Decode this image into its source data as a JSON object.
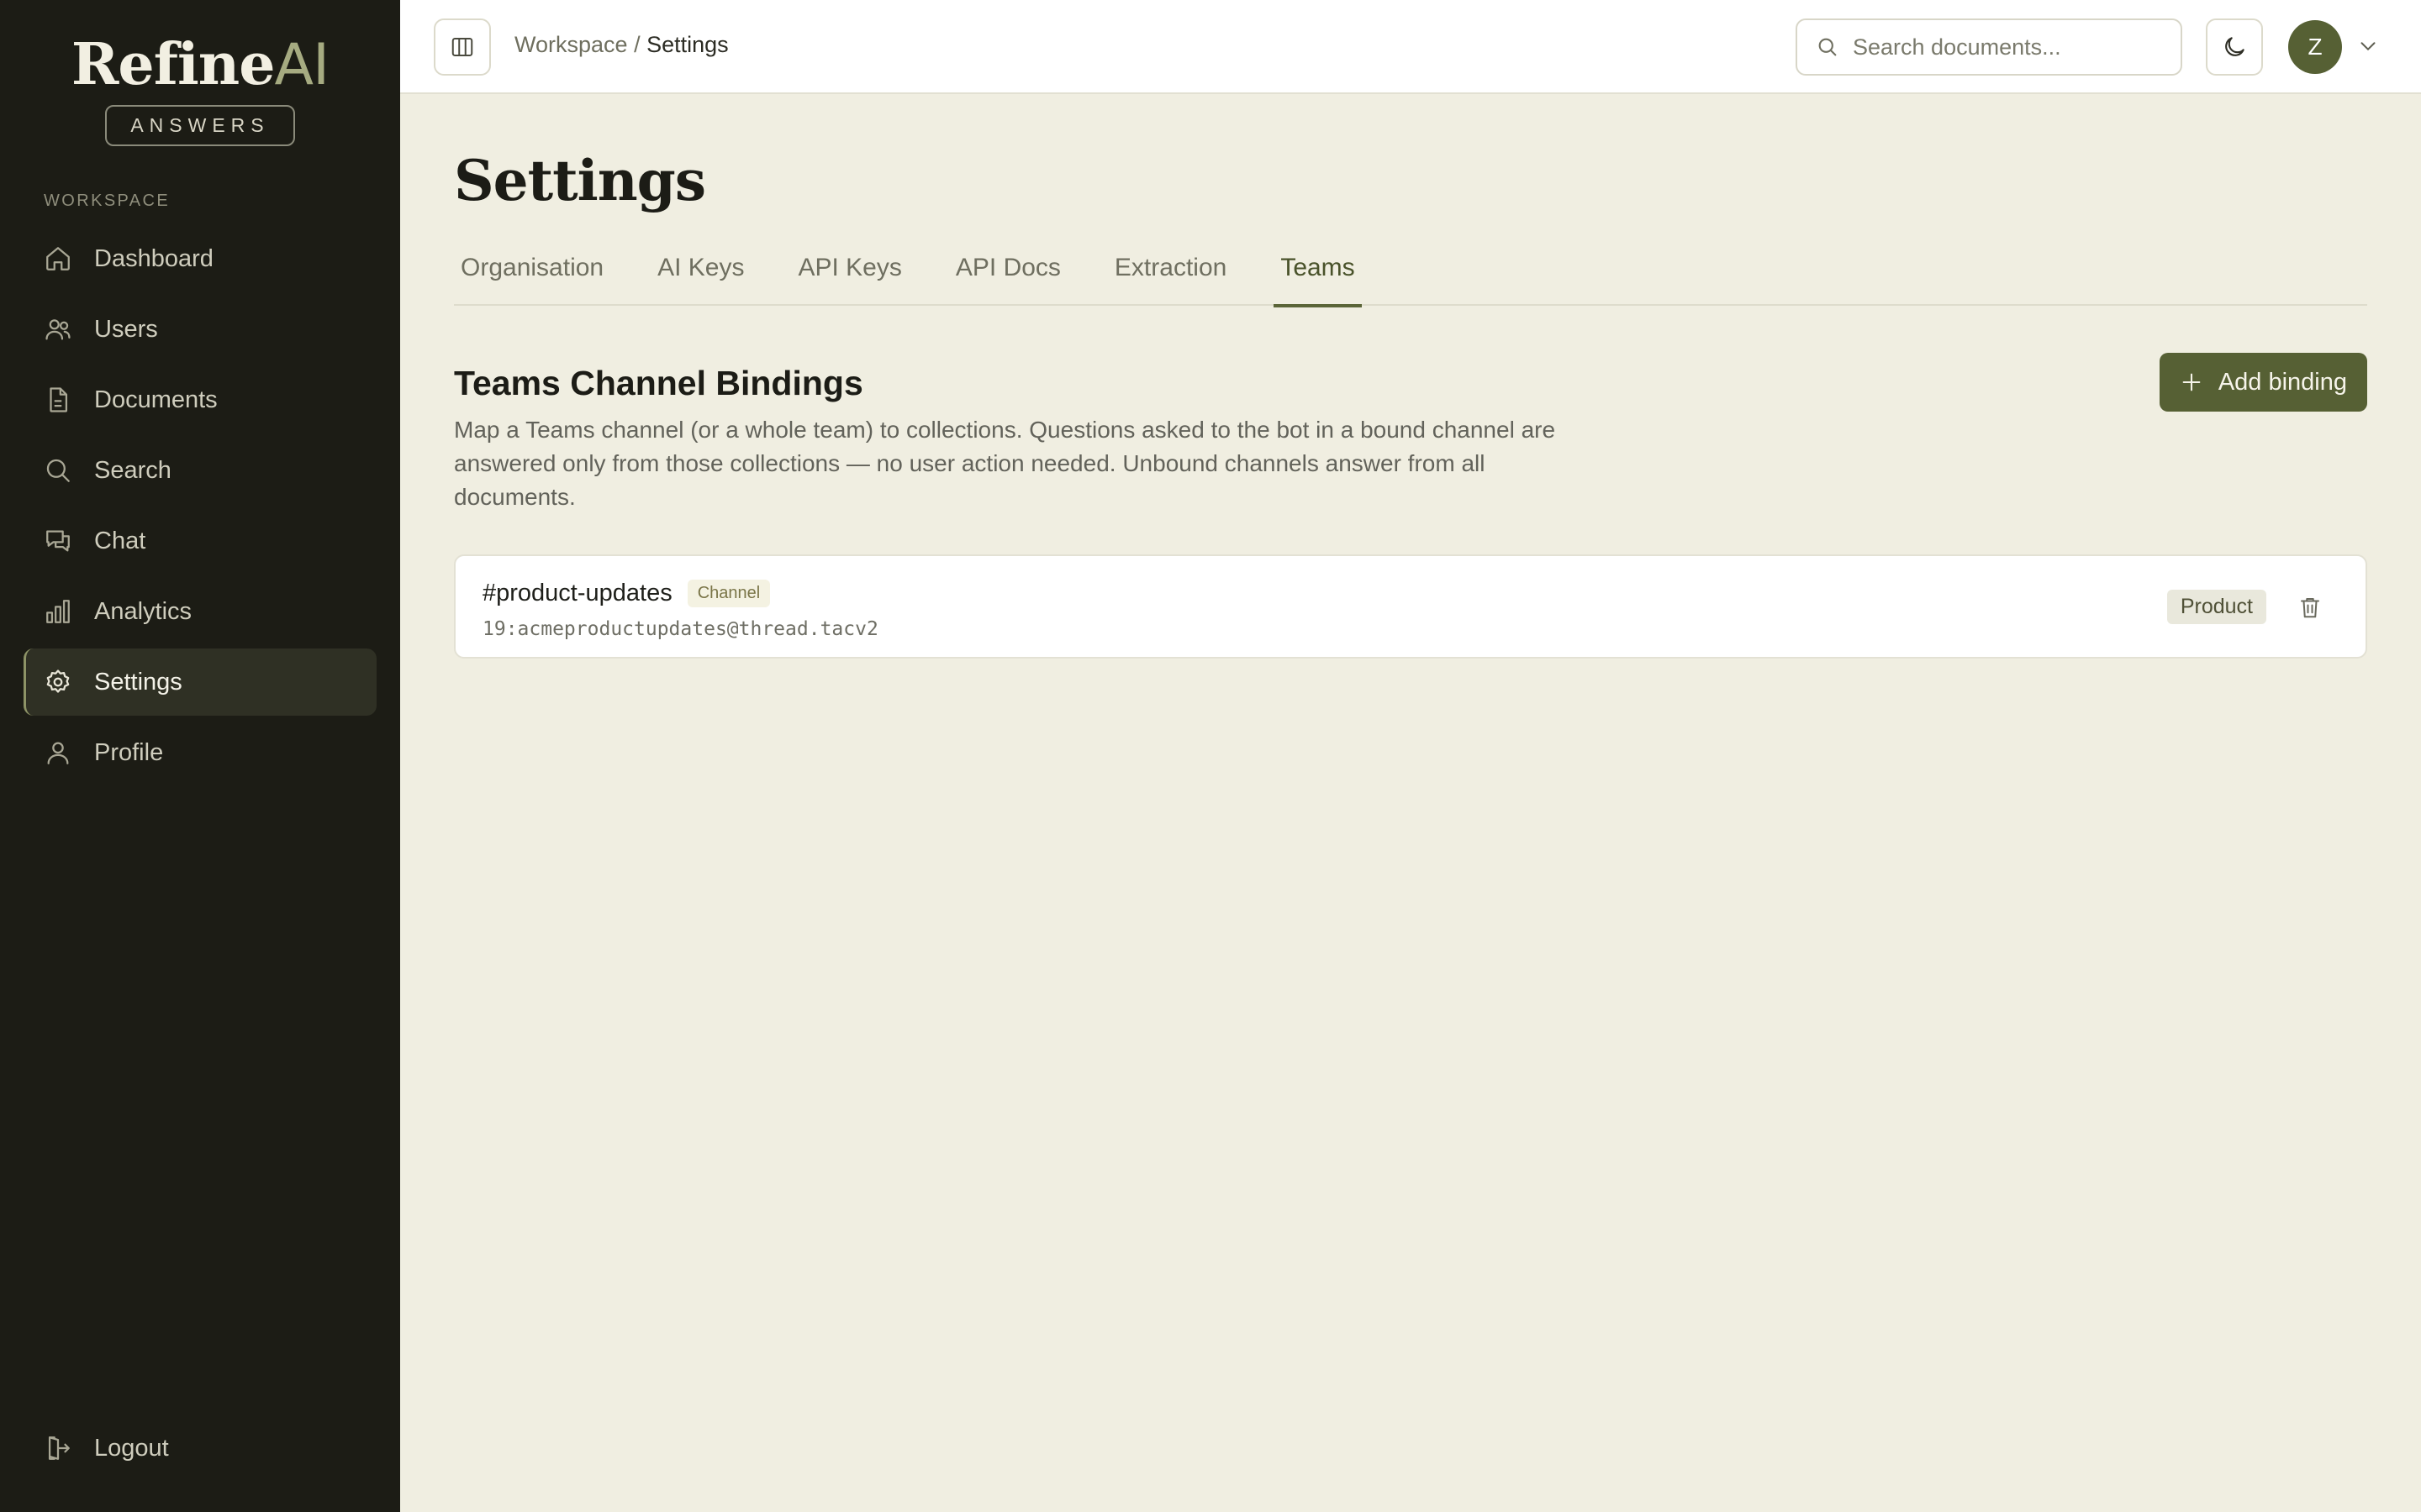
{
  "brand": {
    "name_main": "Refine",
    "name_accent": "AI",
    "badge": "ANSWERS"
  },
  "sidebar": {
    "section_label": "WORKSPACE",
    "items": [
      {
        "label": "Dashboard",
        "icon": "home-icon"
      },
      {
        "label": "Users",
        "icon": "users-icon"
      },
      {
        "label": "Documents",
        "icon": "document-icon"
      },
      {
        "label": "Search",
        "icon": "search-icon"
      },
      {
        "label": "Chat",
        "icon": "chat-icon"
      },
      {
        "label": "Analytics",
        "icon": "bar-chart-icon"
      },
      {
        "label": "Settings",
        "icon": "gear-icon",
        "active": true
      },
      {
        "label": "Profile",
        "icon": "user-icon"
      }
    ],
    "logout_label": "Logout"
  },
  "header": {
    "breadcrumb_root": "Workspace",
    "breadcrumb_sep": " / ",
    "breadcrumb_current": "Settings",
    "search_placeholder": "Search documents...",
    "avatar_initial": "Z"
  },
  "page": {
    "title": "Settings",
    "tabs": [
      {
        "label": "Organisation"
      },
      {
        "label": "AI Keys"
      },
      {
        "label": "API Keys"
      },
      {
        "label": "API Docs"
      },
      {
        "label": "Extraction"
      },
      {
        "label": "Teams",
        "active": true
      }
    ]
  },
  "teams": {
    "title": "Teams Channel Bindings",
    "description": "Map a Teams channel (or a whole team) to collections. Questions asked to the bot in a bound channel are answered only from those collections — no user action needed. Unbound channels answer from all documents.",
    "add_button_label": "Add binding",
    "bindings": [
      {
        "name": "#product-updates",
        "type": "Channel",
        "id": "19:acmeproductupdates@thread.tacv2",
        "collection": "Product"
      }
    ]
  },
  "colors": {
    "sidebar_bg": "#1c1c15",
    "page_bg": "#f0eee1",
    "accent": "#566034"
  }
}
